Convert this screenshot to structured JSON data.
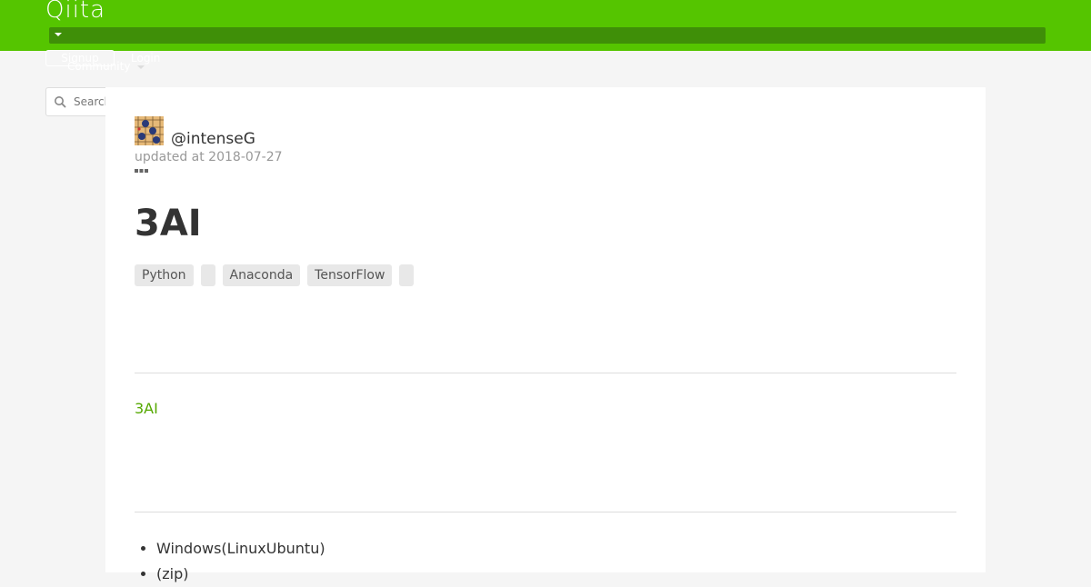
{
  "header": {
    "logo_text": "Qiita",
    "signup_label": "Signup",
    "login_label": "Login",
    "community_label": "Community",
    "brand_color": "#55c500"
  },
  "search": {
    "placeholder": "Search"
  },
  "article": {
    "author": "@intenseG",
    "updated": "updated at 2018-07-27",
    "title": "3AI",
    "tags": [
      "Python",
      "",
      "Anaconda",
      "TensorFlow",
      ""
    ],
    "body_link": "3AI",
    "list_items": [
      "Windows(LinuxUbuntu)",
      "(zip)"
    ]
  }
}
